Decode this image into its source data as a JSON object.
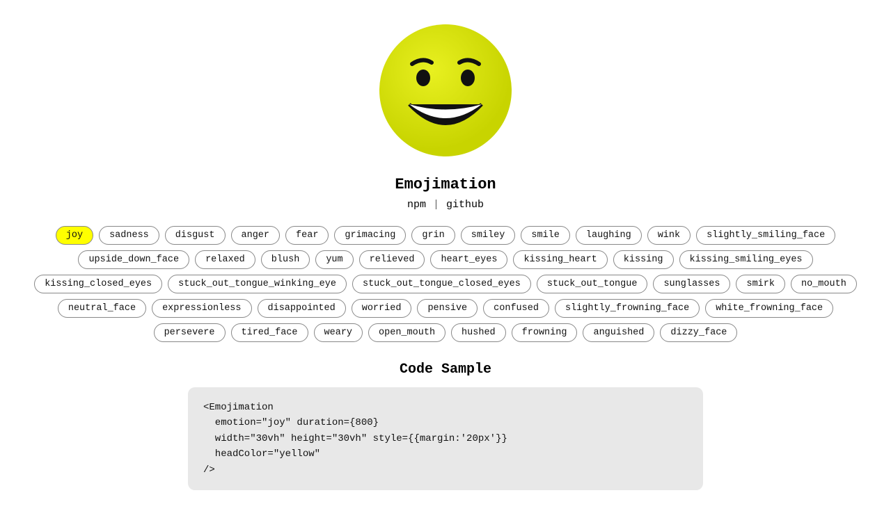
{
  "app": {
    "title": "Emojimation",
    "links": [
      {
        "label": "npm",
        "id": "npm"
      },
      {
        "separator": "|"
      },
      {
        "label": "github",
        "id": "github"
      }
    ]
  },
  "emoji": {
    "active": "joy",
    "head_color": "#d4e000",
    "head_color_highlight": "#e8f020"
  },
  "tags": [
    {
      "id": "joy",
      "label": "joy",
      "active": true
    },
    {
      "id": "sadness",
      "label": "sadness",
      "active": false
    },
    {
      "id": "disgust",
      "label": "disgust",
      "active": false
    },
    {
      "id": "anger",
      "label": "anger",
      "active": false
    },
    {
      "id": "fear",
      "label": "fear",
      "active": false
    },
    {
      "id": "grimacing",
      "label": "grimacing",
      "active": false
    },
    {
      "id": "grin",
      "label": "grin",
      "active": false
    },
    {
      "id": "smiley",
      "label": "smiley",
      "active": false
    },
    {
      "id": "smile",
      "label": "smile",
      "active": false
    },
    {
      "id": "laughing",
      "label": "laughing",
      "active": false
    },
    {
      "id": "wink",
      "label": "wink",
      "active": false
    },
    {
      "id": "slightly_smiling_face",
      "label": "slightly_smiling_face",
      "active": false
    },
    {
      "id": "upside_down_face",
      "label": "upside_down_face",
      "active": false
    },
    {
      "id": "relaxed",
      "label": "relaxed",
      "active": false
    },
    {
      "id": "blush",
      "label": "blush",
      "active": false
    },
    {
      "id": "yum",
      "label": "yum",
      "active": false
    },
    {
      "id": "relieved",
      "label": "relieved",
      "active": false
    },
    {
      "id": "heart_eyes",
      "label": "heart_eyes",
      "active": false
    },
    {
      "id": "kissing_heart",
      "label": "kissing_heart",
      "active": false
    },
    {
      "id": "kissing",
      "label": "kissing",
      "active": false
    },
    {
      "id": "kissing_smiling_eyes",
      "label": "kissing_smiling_eyes",
      "active": false
    },
    {
      "id": "kissing_closed_eyes",
      "label": "kissing_closed_eyes",
      "active": false
    },
    {
      "id": "stuck_out_tongue_winking_eye",
      "label": "stuck_out_tongue_winking_eye",
      "active": false
    },
    {
      "id": "stuck_out_tongue_closed_eyes",
      "label": "stuck_out_tongue_closed_eyes",
      "active": false
    },
    {
      "id": "stuck_out_tongue",
      "label": "stuck_out_tongue",
      "active": false
    },
    {
      "id": "sunglasses",
      "label": "sunglasses",
      "active": false
    },
    {
      "id": "smirk",
      "label": "smirk",
      "active": false
    },
    {
      "id": "no_mouth",
      "label": "no_mouth",
      "active": false
    },
    {
      "id": "neutral_face",
      "label": "neutral_face",
      "active": false
    },
    {
      "id": "expressionless",
      "label": "expressionless",
      "active": false
    },
    {
      "id": "disappointed",
      "label": "disappointed",
      "active": false
    },
    {
      "id": "worried",
      "label": "worried",
      "active": false
    },
    {
      "id": "pensive",
      "label": "pensive",
      "active": false
    },
    {
      "id": "confused",
      "label": "confused",
      "active": false
    },
    {
      "id": "slightly_frowning_face",
      "label": "slightly_frowning_face",
      "active": false
    },
    {
      "id": "white_frowning_face",
      "label": "white_frowning_face",
      "active": false
    },
    {
      "id": "persevere",
      "label": "persevere",
      "active": false
    },
    {
      "id": "tired_face",
      "label": "tired_face",
      "active": false
    },
    {
      "id": "weary",
      "label": "weary",
      "active": false
    },
    {
      "id": "open_mouth",
      "label": "open_mouth",
      "active": false
    },
    {
      "id": "hushed",
      "label": "hushed",
      "active": false
    },
    {
      "id": "frowning",
      "label": "frowning",
      "active": false
    },
    {
      "id": "anguished",
      "label": "anguished",
      "active": false
    },
    {
      "id": "dizzy_face",
      "label": "dizzy_face",
      "active": false
    }
  ],
  "code_sample": {
    "title": "Code Sample",
    "code": "<Emojimation\n  emotion=\"joy\" duration={800}\n  width=\"30vh\" height=\"30vh\" style={{margin:'20px'}}\n  headColor=\"yellow\"\n/>"
  }
}
